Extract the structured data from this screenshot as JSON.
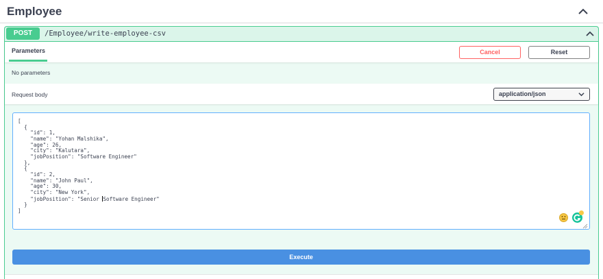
{
  "tag": {
    "title": "Employee"
  },
  "operation": {
    "method": "POST",
    "path": "/Employee/write-employee-csv"
  },
  "parameters": {
    "tab_label": "Parameters",
    "cancel_label": "Cancel",
    "reset_label": "Reset",
    "empty_text": "No parameters"
  },
  "request_body": {
    "label": "Request body",
    "content_type": "application/json",
    "lines_before_caret": [
      "[",
      "  {",
      "    \"id\": 1,",
      "    \"name\": \"Yohan Malshika\",",
      "    \"age\": 26,",
      "    \"city\": \"Kalutara\",",
      "    \"jobPosition\": \"Software Engineer\"",
      "  },",
      "  {",
      "    \"id\": 2,",
      "    \"name\": \"John Paul\",",
      "    \"age\": 30,",
      "    \"city\": \"New York\","
    ],
    "caret_line_before": "    \"jobPosition\": \"Senior ",
    "caret_line_after": "Software Engineer\"",
    "lines_after_caret": [
      "  }",
      "]"
    ]
  },
  "execute_label": "Execute",
  "icons": {
    "tag_toggle": "chevron-up-icon",
    "op_toggle": "chevron-up-icon",
    "select": "chevron-down-icon",
    "emoji": "emoji-face-icon",
    "grammarly": "grammarly-icon",
    "resize": "resize-handle-icon"
  },
  "colors": {
    "post": "#49cc90",
    "cancel": "#ff6060",
    "execute": "#4990e2",
    "editor_border": "#61affe"
  }
}
